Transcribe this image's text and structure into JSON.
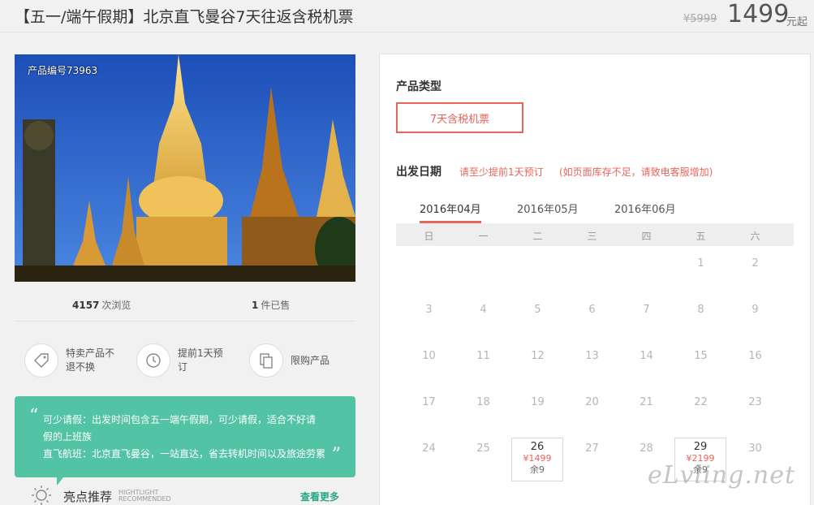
{
  "header": {
    "title": "【五一/端午假期】北京直飞曼谷7天往返含税机票",
    "old_price": "¥5999",
    "price": "1499",
    "price_unit": "元起"
  },
  "photo": {
    "code": "产品编号73963"
  },
  "stats": {
    "views": "4157",
    "views_label": "次浏览",
    "sold": "1",
    "sold_label": "件已售"
  },
  "features": [
    {
      "icon": "tag-icon",
      "text": "特卖产品不退不换"
    },
    {
      "icon": "clock-icon",
      "text": "提前1天预订"
    },
    {
      "icon": "copy-icon",
      "text": "限购产品"
    }
  ],
  "highlight": {
    "line1": "可少请假：出发时间包含五一端午假期，可少请假，适合不好请假的上班族",
    "line2": "直飞航班：北京直飞曼谷，一站直达，省去转机时间以及旅途劳累"
  },
  "recommend": {
    "title": "亮点推荐",
    "en_line1": "HIGHTLIGHT",
    "en_line2": "RECOMMENDED",
    "more": "查看更多"
  },
  "product_type": {
    "title": "产品类型",
    "option": "7天含税机票"
  },
  "departure": {
    "title": "出发日期",
    "tip1": "请至少提前1天预订",
    "tip2": "(如页面库存不足，请致电客服增加)"
  },
  "months": [
    "2016年04月",
    "2016年05月",
    "2016年06月"
  ],
  "active_month": 0,
  "weekdays": [
    "日",
    "一",
    "二",
    "三",
    "四",
    "五",
    "六"
  ],
  "calendar": {
    "first_weekday": 5,
    "days_shown": 30,
    "available": [
      {
        "day": "26",
        "price": "¥1499",
        "stock": "余9"
      },
      {
        "day": "29",
        "price": "¥2199",
        "stock": "余9"
      }
    ]
  },
  "watermark": "eLvling.net",
  "colors": {
    "accent": "#e8655a",
    "highlight_bg": "#52c4a4",
    "more_link": "#2aa786"
  }
}
